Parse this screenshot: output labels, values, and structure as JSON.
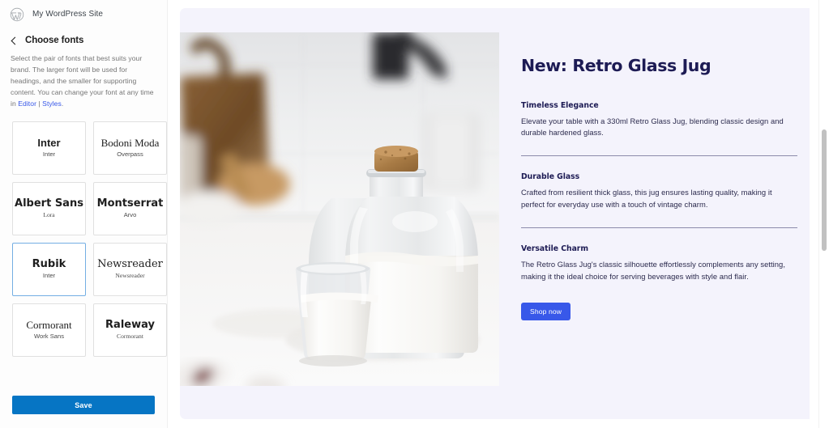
{
  "sidebar": {
    "site_title": "My WordPress Site",
    "logo_icon": "wordpress-logo-icon",
    "back_icon": "chevron-left-icon",
    "panel_title": "Choose fonts",
    "description": {
      "part1": "Select the pair of fonts that best suits your brand. The larger font will be used for headings, and the smaller for supporting content. You can change your font at any time in ",
      "link1": "Editor",
      "separator": " | ",
      "link2": "Styles",
      "part2": "."
    },
    "font_pairs": [
      {
        "heading": "Inter",
        "body": "Inter",
        "selected": false,
        "heading_style": "f-sans",
        "body_style": "f-sans-reg"
      },
      {
        "heading": "Bodoni Moda",
        "body": "Overpass",
        "selected": false,
        "heading_style": "f-serif",
        "body_style": "f-sans-reg"
      },
      {
        "heading": "Albert Sans",
        "body": "Lora",
        "selected": false,
        "heading_style": "f-dsans",
        "body_style": "f-serif"
      },
      {
        "heading": "Montserrat",
        "body": "Arvo",
        "selected": false,
        "heading_style": "f-dsans",
        "body_style": "f-sans-reg"
      },
      {
        "heading": "Rubik",
        "body": "Inter",
        "selected": true,
        "heading_style": "f-dsans",
        "body_style": "f-sans-reg"
      },
      {
        "heading": "Newsreader",
        "body": "Newsreader",
        "selected": false,
        "heading_style": "f-dserif",
        "body_style": "f-serif"
      },
      {
        "heading": "Cormorant",
        "body": "Work Sans",
        "selected": false,
        "heading_style": "f-serif",
        "body_style": "f-sans-reg"
      },
      {
        "heading": "Raleway",
        "body": "Cormorant",
        "selected": false,
        "heading_style": "f-dsans",
        "body_style": "f-serif"
      }
    ],
    "save_label": "Save"
  },
  "preview": {
    "hero_image_alt": "glass milk jug with cork stopper and glass of milk on white kitchen counter",
    "title": "New: Retro Glass Jug",
    "features": [
      {
        "title": "Timeless Elegance",
        "body": "Elevate your table with a 330ml Retro Glass Jug, blending classic design and durable hardened glass."
      },
      {
        "title": "Durable Glass",
        "body": "Crafted from resilient thick glass, this jug ensures lasting quality, making it perfect for everyday use with a touch of vintage charm."
      },
      {
        "title": "Versatile Charm",
        "body": "The Retro Glass Jug's classic silhouette effortlessly complements any setting, making it the ideal choice for serving beverages with style and flair."
      }
    ],
    "cta_label": "Shop now"
  },
  "colors": {
    "save_button": "#0675C4",
    "cta_button": "#3858E9",
    "link": "#3858E9",
    "selected_card_border": "#74AEE3",
    "preview_background": "#F4F3FC",
    "heading_text": "#1D1B54"
  }
}
